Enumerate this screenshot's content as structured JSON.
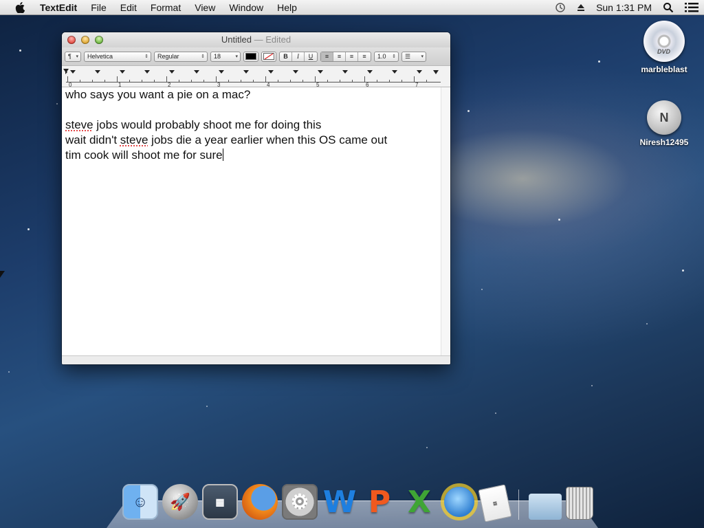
{
  "menubar": {
    "app_name": "TextEdit",
    "items": [
      "File",
      "Edit",
      "Format",
      "View",
      "Window",
      "Help"
    ],
    "clock": "Sun 1:31 PM"
  },
  "desktop": {
    "icons": [
      {
        "label": "marbleblast",
        "icon": "dvd-icon"
      },
      {
        "label": "Niresh12495",
        "icon": "drive-icon",
        "badge": "N"
      }
    ],
    "dvd_badge": "DVD"
  },
  "window": {
    "title": "Untitled",
    "status": "Edited",
    "toolbar": {
      "paragraph_style": "¶",
      "font_family": "Helvetica",
      "font_style": "Regular",
      "font_size": "18",
      "bold": "B",
      "italic": "I",
      "underline": "U",
      "line_spacing": "1.0"
    },
    "ruler_numbers": [
      "0",
      "1",
      "2",
      "3",
      "4",
      "5",
      "6",
      "7"
    ]
  },
  "document": {
    "lines": [
      "who says you want a pie on a mac?",
      "",
      "steve jobs would probably shoot me for doing this",
      "wait didn't steve jobs die a year earlier when this OS came out",
      "tim cook will shoot me for sure"
    ],
    "misspelled": [
      "steve",
      "steve"
    ]
  },
  "dock": {
    "apps": [
      "Finder",
      "Launchpad",
      "Image Capture",
      "Firefox",
      "System Preferences",
      "Word",
      "PowerPoint",
      "Excel",
      "Entourage",
      "TextEdit",
      "Documents",
      "Trash"
    ]
  }
}
